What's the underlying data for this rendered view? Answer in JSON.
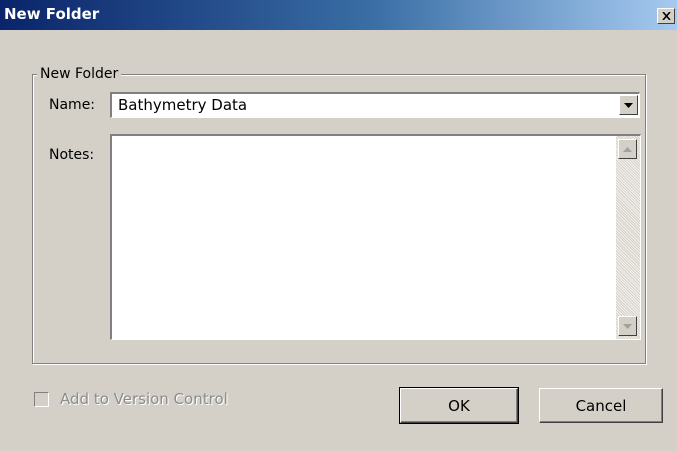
{
  "window": {
    "title": "New Folder",
    "close_glyph": "✕"
  },
  "group": {
    "legend": "New Folder"
  },
  "form": {
    "name_label": "Name:",
    "name_value": "Bathymetry Data",
    "notes_label": "Notes:",
    "notes_value": ""
  },
  "options": {
    "version_control_label": "Add to Version Control",
    "version_control_checked": false,
    "version_control_enabled": false
  },
  "buttons": {
    "ok_label": "OK",
    "cancel_label": "Cancel"
  },
  "icons": {
    "close": "close-icon",
    "dropdown": "chevron-down-icon",
    "scroll_up": "scroll-up-arrow-icon",
    "scroll_down": "scroll-down-arrow-icon"
  },
  "colors": {
    "titlebar_start": "#0a246a",
    "titlebar_end": "#a6caf0",
    "face": "#d4d0c8",
    "disabled_text": "#8c8c8c"
  }
}
